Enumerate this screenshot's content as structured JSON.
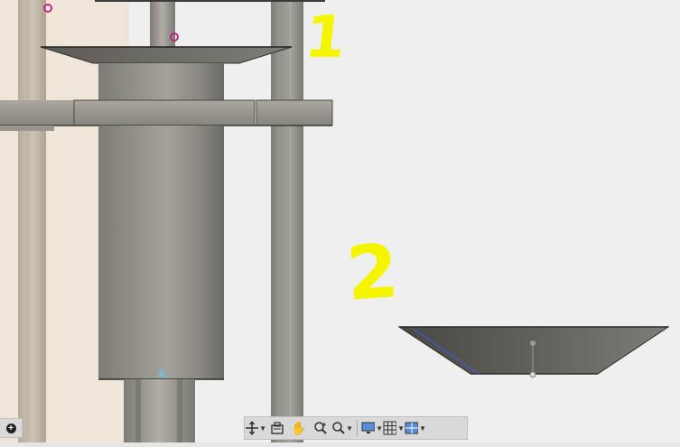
{
  "app": {
    "view": "3d-viewport"
  },
  "annotations": [
    {
      "label": "1",
      "color": "#f5f500"
    },
    {
      "label": "2",
      "color": "#f5f500"
    }
  ],
  "colors": {
    "background": "#efefef",
    "left_panel": "#efe5d8",
    "part_dark": "#5e5c57",
    "part_light": "#9b9890",
    "marker": "#c0287e",
    "edge_highlight": "#3b5bd9"
  },
  "navigation_bar": {
    "tools": [
      {
        "name": "orbit",
        "icon": "orbit-icon",
        "has_dropdown": true
      },
      {
        "name": "look-at",
        "icon": "look-at-icon",
        "has_dropdown": false
      },
      {
        "name": "pan",
        "icon": "hand-icon",
        "has_dropdown": false
      },
      {
        "name": "zoom",
        "icon": "zoom-icon",
        "has_dropdown": false
      },
      {
        "name": "fit",
        "icon": "zoom-window-icon",
        "has_dropdown": true
      },
      {
        "name": "display-settings",
        "icon": "monitor-icon",
        "has_dropdown": true
      },
      {
        "name": "grid-and-snaps",
        "icon": "grid-icon",
        "has_dropdown": true
      },
      {
        "name": "viewports",
        "icon": "viewports-icon",
        "has_dropdown": true
      }
    ]
  }
}
